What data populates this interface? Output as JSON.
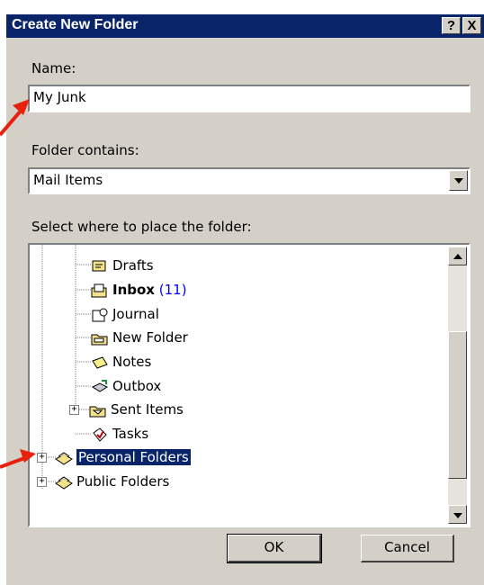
{
  "dialog": {
    "title": "Create New Folder",
    "help_button": "?",
    "close_button": "X"
  },
  "name_field": {
    "label": "Name:",
    "value": "My Junk"
  },
  "contains": {
    "label": "Folder contains:",
    "value": "Mail Items"
  },
  "location": {
    "label": "Select where to place the folder:"
  },
  "tree": {
    "items": [
      {
        "label": "Drafts",
        "count": "",
        "icon": "drafts-icon"
      },
      {
        "label": "Inbox",
        "count": "(11)",
        "icon": "inbox-icon"
      },
      {
        "label": "Journal",
        "count": "",
        "icon": "journal-icon"
      },
      {
        "label": "New Folder",
        "count": "",
        "icon": "folder-icon"
      },
      {
        "label": "Notes",
        "count": "",
        "icon": "notes-icon"
      },
      {
        "label": "Outbox",
        "count": "",
        "icon": "outbox-icon"
      },
      {
        "label": "Sent Items",
        "count": "",
        "icon": "sent-items-icon",
        "expander": "+"
      },
      {
        "label": "Tasks",
        "count": "",
        "icon": "tasks-icon"
      },
      {
        "label": "Personal Folders",
        "count": "",
        "icon": "personal-folders-icon",
        "expander": "+",
        "selected": true
      },
      {
        "label": "Public Folders",
        "count": "",
        "icon": "public-folders-icon",
        "expander": "+"
      }
    ]
  },
  "buttons": {
    "ok": "OK",
    "cancel": "Cancel"
  },
  "colors": {
    "titlebar": "#0a246a",
    "dialog_bg": "#d4d0c8",
    "selection": "#0a246a",
    "annotation_arrow": "#e8210f"
  }
}
